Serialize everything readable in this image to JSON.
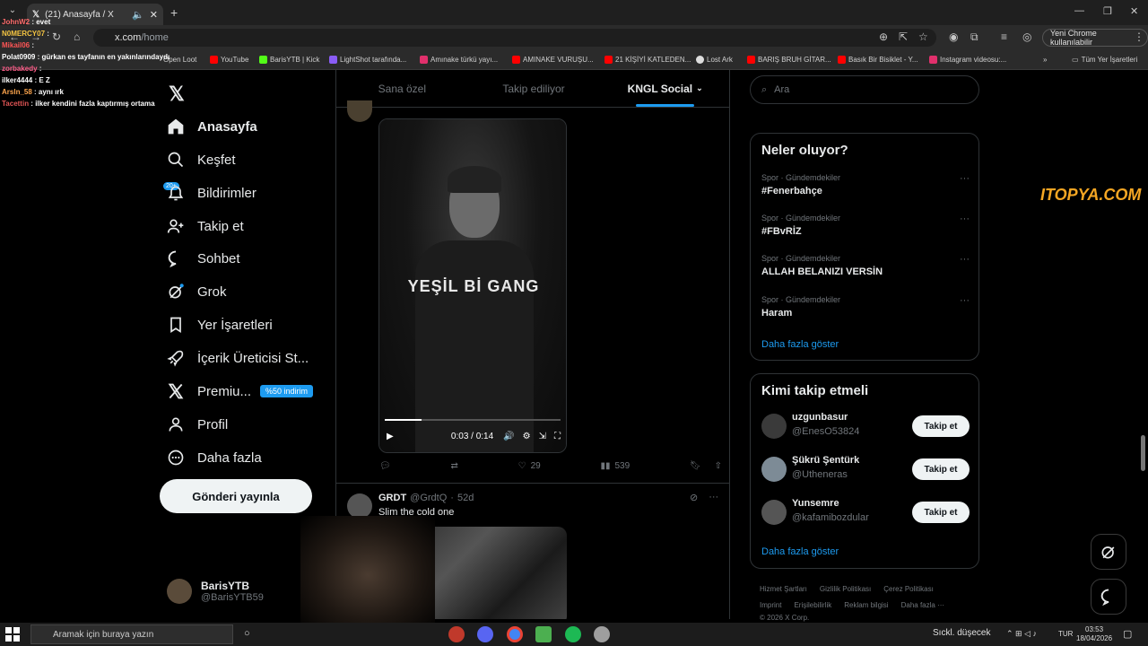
{
  "browser": {
    "tab_title": "(21) Anasayfa / X",
    "address_host": "x.com",
    "address_path": "/home",
    "profile_button": "Yeni Chrome kullanılabilir",
    "bookmarks": [
      "BarisYTB | Kick",
      "LightShot tarafında...",
      "Amınake türkü yayı...",
      "AMINAKE VURUŞU...",
      "21 KİŞİYİ KATLEDEN...",
      "Lost Ark",
      "BARIŞ BRUH GİTAR...",
      "Basık Bir Bisiklet - Y...",
      "Instagram videosu:..."
    ],
    "bookmarks_lead": [
      "Open Loot",
      "YouTube"
    ],
    "all_bookmarks": "Tüm Yer İşaretleri"
  },
  "chat": [
    {
      "user": "JohnW2",
      "msg": "evet",
      "color": "#ff6b6b"
    },
    {
      "user": "N0MERCY07",
      "msg": "",
      "color": "#f5c542"
    },
    {
      "user": "Mikail06",
      "msg": "",
      "color": "#ff5555"
    },
    {
      "user": "Polat0909",
      "msg": "gürkan es tayfanın en yakınlarındaydı",
      "color": "#ffffff"
    },
    {
      "user": "zorbakedy",
      "msg": "",
      "color": "#ff5e8a"
    },
    {
      "user": "ilker4444",
      "msg": "E Z",
      "color": "#ffffff"
    },
    {
      "user": "Arsln_58",
      "msg": "aynı ırk",
      "color": "#ffa64d"
    },
    {
      "user": "Tacettin",
      "msg": "ilker kendini fazla kaptırmış ortama",
      "color": "#e05555"
    }
  ],
  "nav": {
    "home": "Anasayfa",
    "explore": "Keşfet",
    "notifications": "Bildirimler",
    "notif_badge": "20+",
    "follow": "Takip et",
    "chat": "Sohbet",
    "grok": "Grok",
    "bookmarks": "Yer İşaretleri",
    "creator": "İçerik Üreticisi St...",
    "premium": "Premiu...",
    "premium_badge": "%50 indirim",
    "profile": "Profil",
    "more": "Daha fazla",
    "post_button": "Gönderi yayınla",
    "account_name": "BarisYTB",
    "account_handle": "@BarisYTB59"
  },
  "feed_tabs": [
    "Sana özel",
    "Takip ediliyor",
    "KNGL Social"
  ],
  "post1": {
    "video_caption": "YEŞİL Bİ GANG",
    "time": "0:03 / 0:14",
    "progress": 0.21,
    "likes": "29",
    "views": "539"
  },
  "post2": {
    "name": "GRDT",
    "handle": "@GrdtQ",
    "dot": "·",
    "age": "52d",
    "text": "Slim the cold one"
  },
  "search": {
    "placeholder": "Ara"
  },
  "trends": {
    "title": "Neler oluyor?",
    "items": [
      {
        "cat": "Spor · Gündemdekiler",
        "title": "#Fenerbahçe"
      },
      {
        "cat": "Spor · Gündemdekiler",
        "title": "#FBvRİZ"
      },
      {
        "cat": "Spor · Gündemdekiler",
        "title": "ALLAH BELANIZI VERSİN"
      },
      {
        "cat": "Spor · Gündemdekiler",
        "title": "Haram"
      }
    ],
    "show_more": "Daha fazla göster"
  },
  "who": {
    "title": "Kimi takip etmeli",
    "items": [
      {
        "name": "uzgunbasur",
        "handle": "@EnesO53824",
        "button": "Takip et"
      },
      {
        "name": "Şükrü Şentürk",
        "handle": "@Utheneras",
        "button": "Takip et"
      },
      {
        "name": "Yunsemre",
        "handle": "@kafamibozdular",
        "button": "Takip et"
      }
    ],
    "show_more": "Daha fazla göster"
  },
  "footer": [
    "Hizmet Şartları",
    "Gizlilik Politikası",
    "Çerez Politikası",
    "Imprint",
    "Erişilebilirlik",
    "Reklam bilgisi",
    "Daha fazla ···",
    "© 2026 X Corp."
  ],
  "watermark": "ITOPYA.COM",
  "taskbar": {
    "search_placeholder": "Aramak için buraya yazın",
    "weather": "Sıckl. düşecek",
    "lang": "TUR",
    "time": "03:53",
    "date": "18/04/2026"
  }
}
